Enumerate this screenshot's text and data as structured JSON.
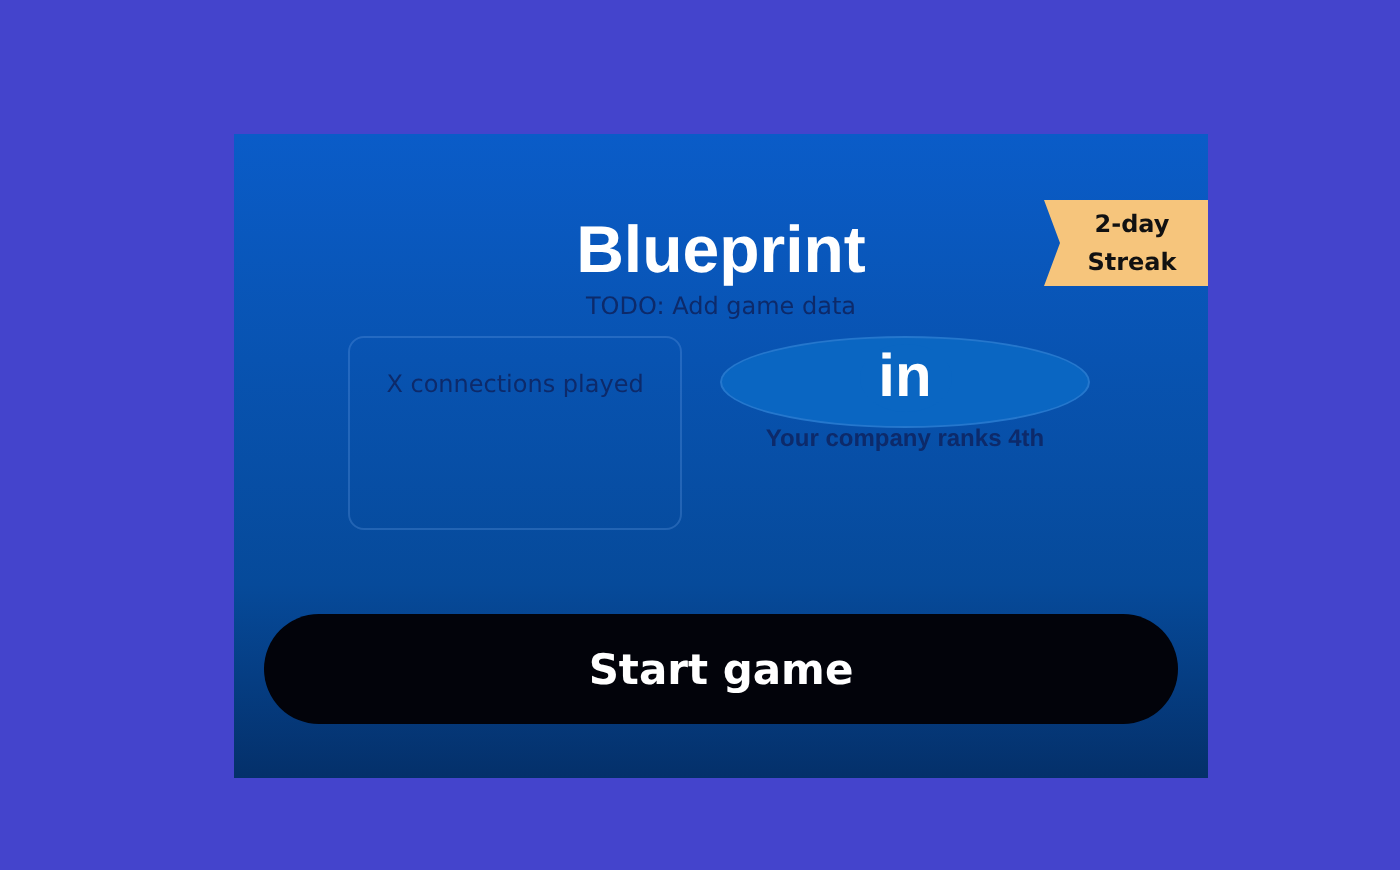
{
  "title": "Blueprint",
  "subtitle": "TODO: Add game data",
  "streak": {
    "line_1": "2-day",
    "line_2": "Streak"
  },
  "tiles": [
    {
      "kind": "text",
      "text": "X connections played"
    },
    {
      "kind": "logo",
      "logo_text": "in",
      "text": "Your company ranks 4th"
    }
  ],
  "start_button": "Start game"
}
